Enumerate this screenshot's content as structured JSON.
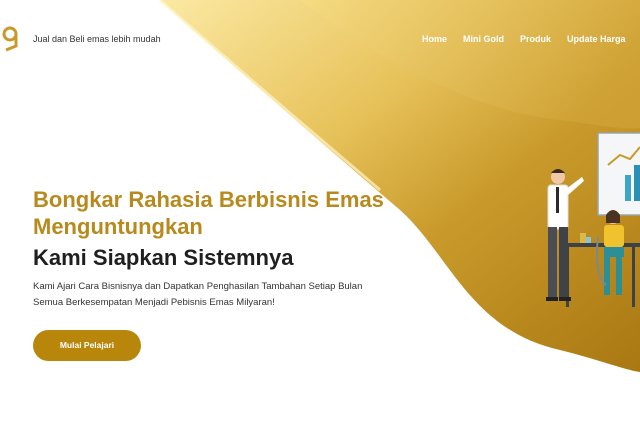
{
  "header": {
    "logo_icon": "gold-logo-icon",
    "tagline": "Jual dan Beli emas lebih mudah"
  },
  "nav": {
    "items": [
      {
        "label": "Home"
      },
      {
        "label": "Mini Gold"
      },
      {
        "label": "Produk"
      },
      {
        "label": "Update Harga"
      }
    ]
  },
  "hero": {
    "title_line1": "Bongkar Rahasia Berbisnis Emas",
    "title_line2": "Menguntungkan",
    "subtitle": "Kami Siapkan Sistemnya",
    "desc_line1": "Kami Ajari Cara Bisnisnya dan Dapatkan Penghasilan Tambahan Setiap Bulan",
    "desc_line2": "Semua Berkesempatan Menjadi Pebisnis Emas Milyaran!",
    "cta_label": "Mulai Pelajari"
  },
  "colors": {
    "gold": "#b8860b",
    "gold_light": "#f3d674",
    "heading_gold": "#b88a1e",
    "dark_text": "#1f1f1f"
  },
  "illustration": {
    "icon": "business-people-chart-illustration"
  }
}
